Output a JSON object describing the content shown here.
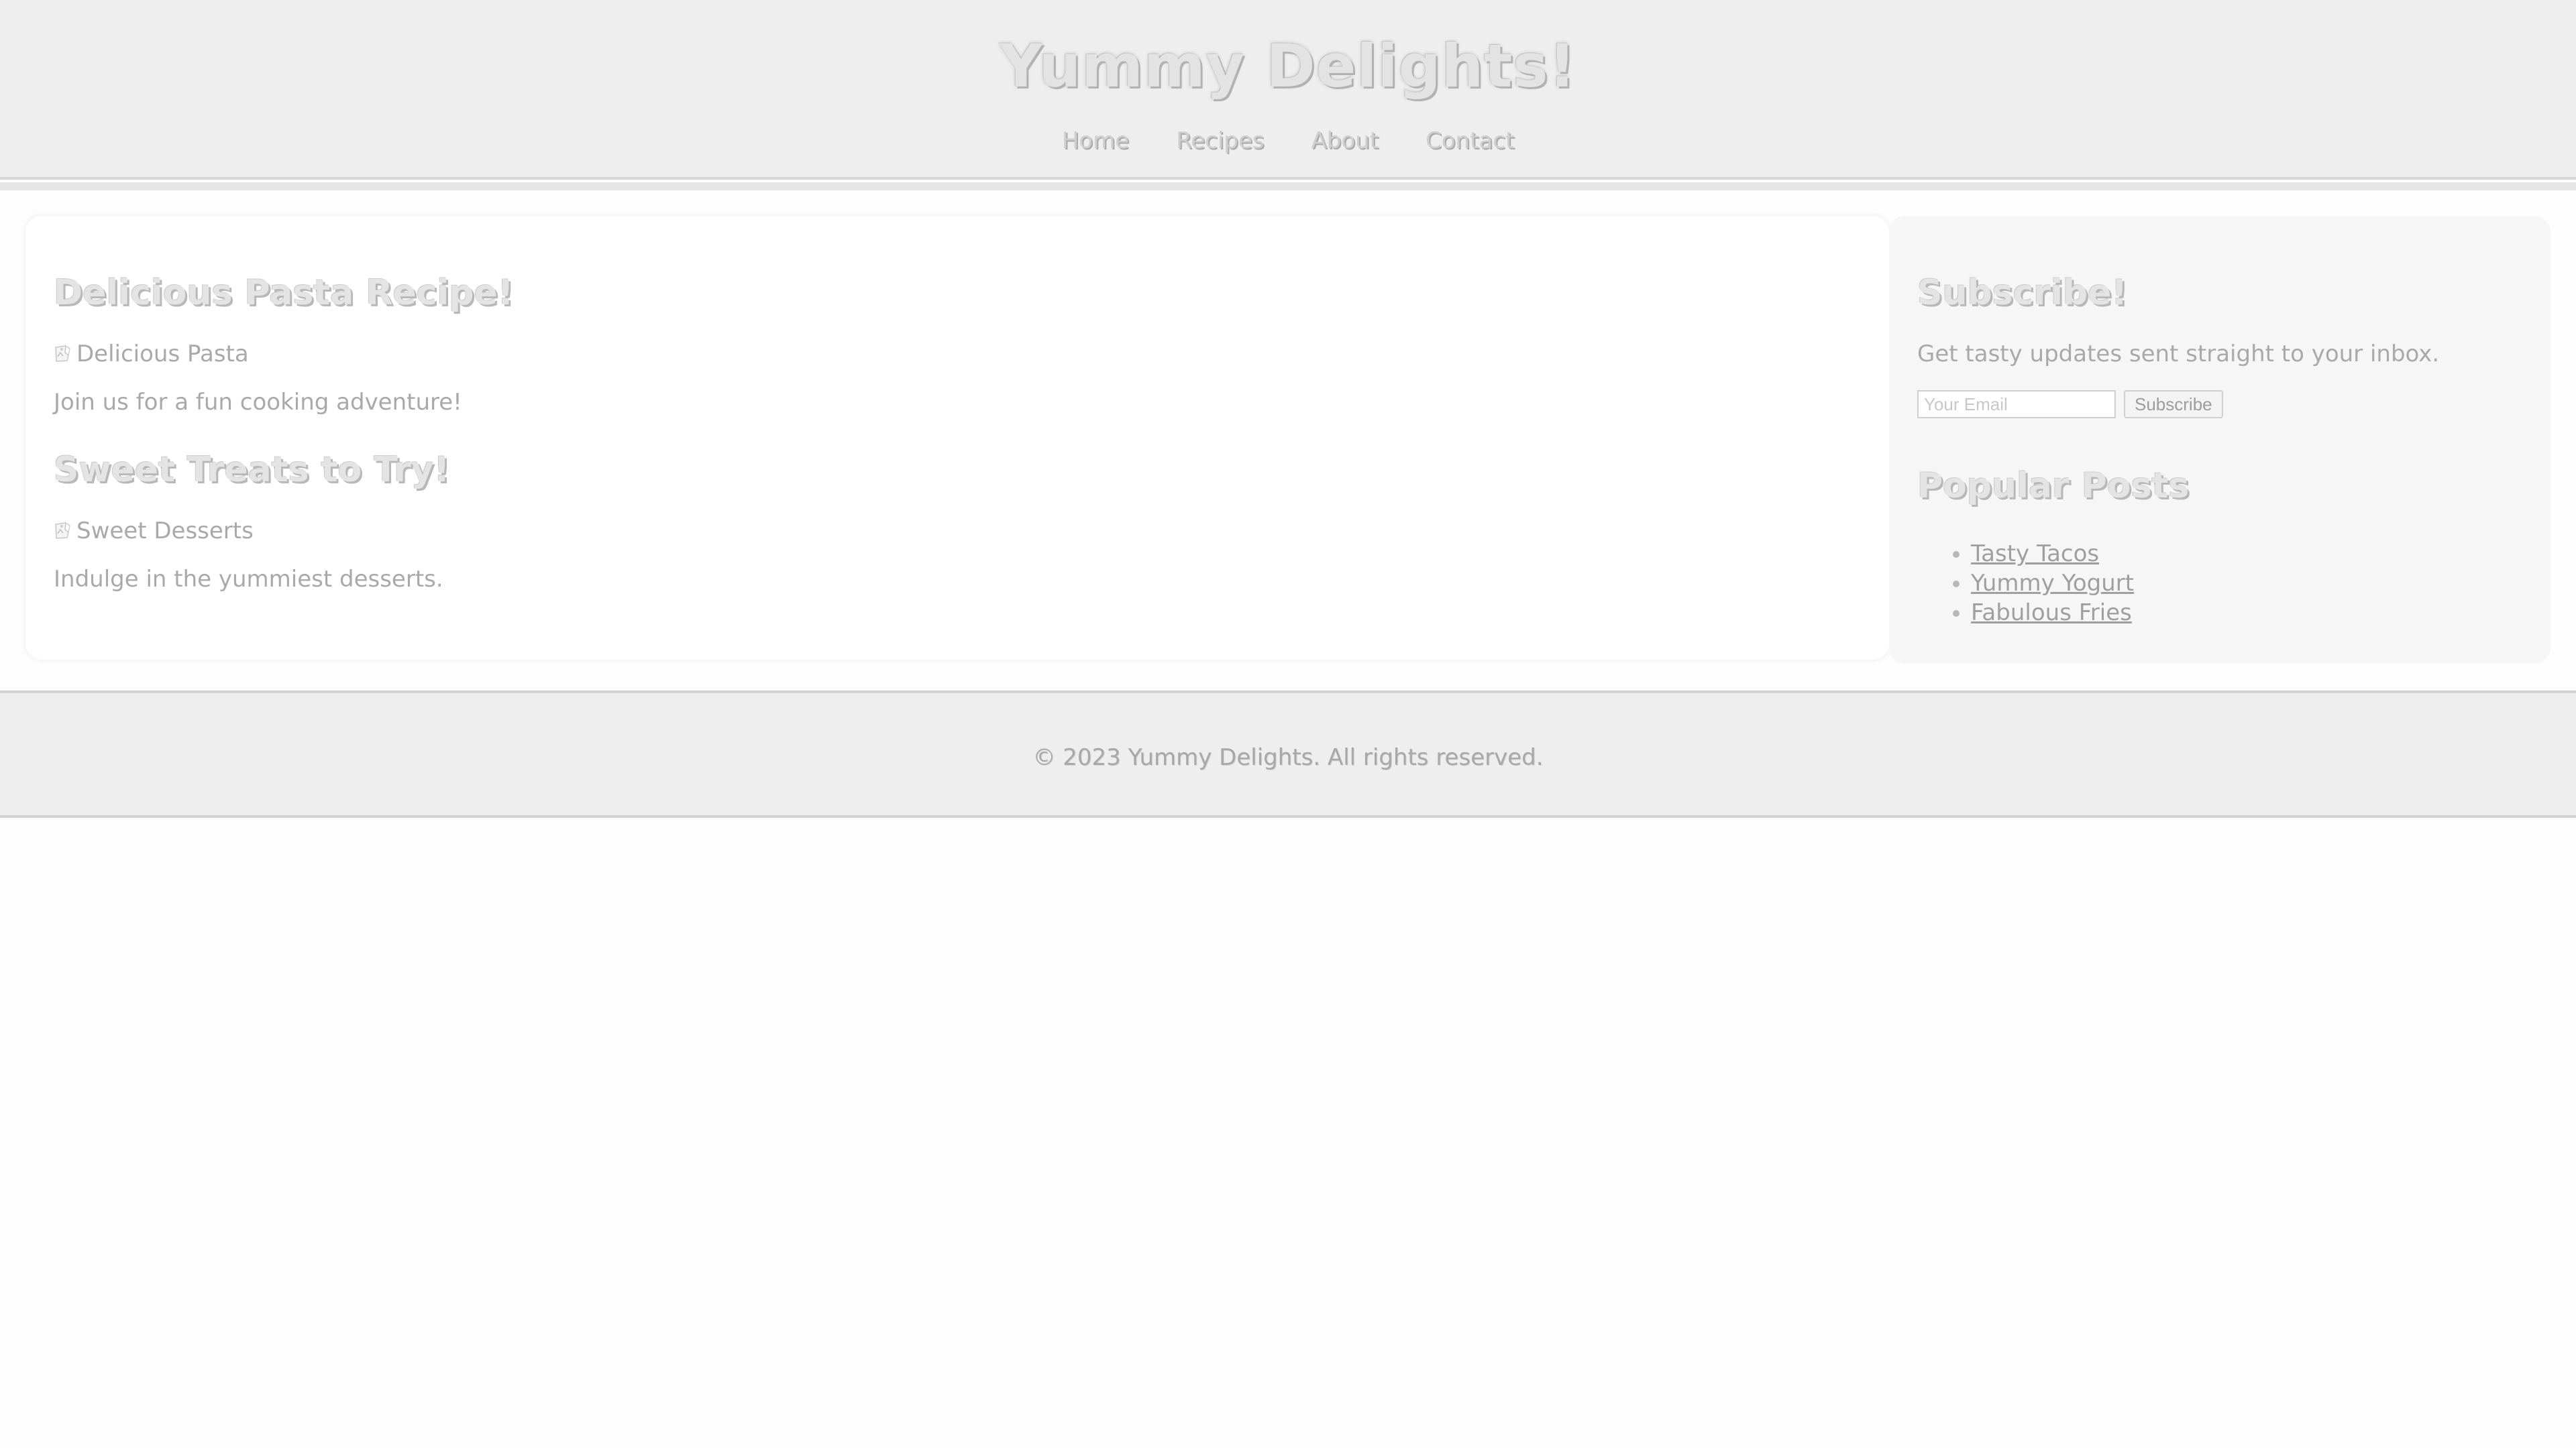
{
  "header": {
    "title": "Yummy Delights!",
    "nav": [
      "Home",
      "Recipes",
      "About",
      "Contact"
    ]
  },
  "main": {
    "posts": [
      {
        "heading": "Delicious Pasta Recipe!",
        "image_alt": "Delicious Pasta",
        "text": "Join us for a fun cooking adventure!"
      },
      {
        "heading": "Sweet Treats to Try!",
        "image_alt": "Sweet Desserts",
        "text": "Indulge in the yummiest desserts."
      }
    ]
  },
  "sidebar": {
    "subscribe_heading": "Subscribe!",
    "subscribe_text": "Get tasty updates sent straight to your inbox.",
    "email_placeholder": "Your Email",
    "subscribe_button": "Subscribe",
    "popular_heading": "Popular Posts",
    "popular_posts": [
      "Tasty Tacos",
      "Yummy Yogurt",
      "Fabulous Fries"
    ]
  },
  "footer": {
    "text": "© 2023 Yummy Delights. All rights reserved."
  },
  "icons": {
    "broken_image": "broken-image-icon"
  }
}
